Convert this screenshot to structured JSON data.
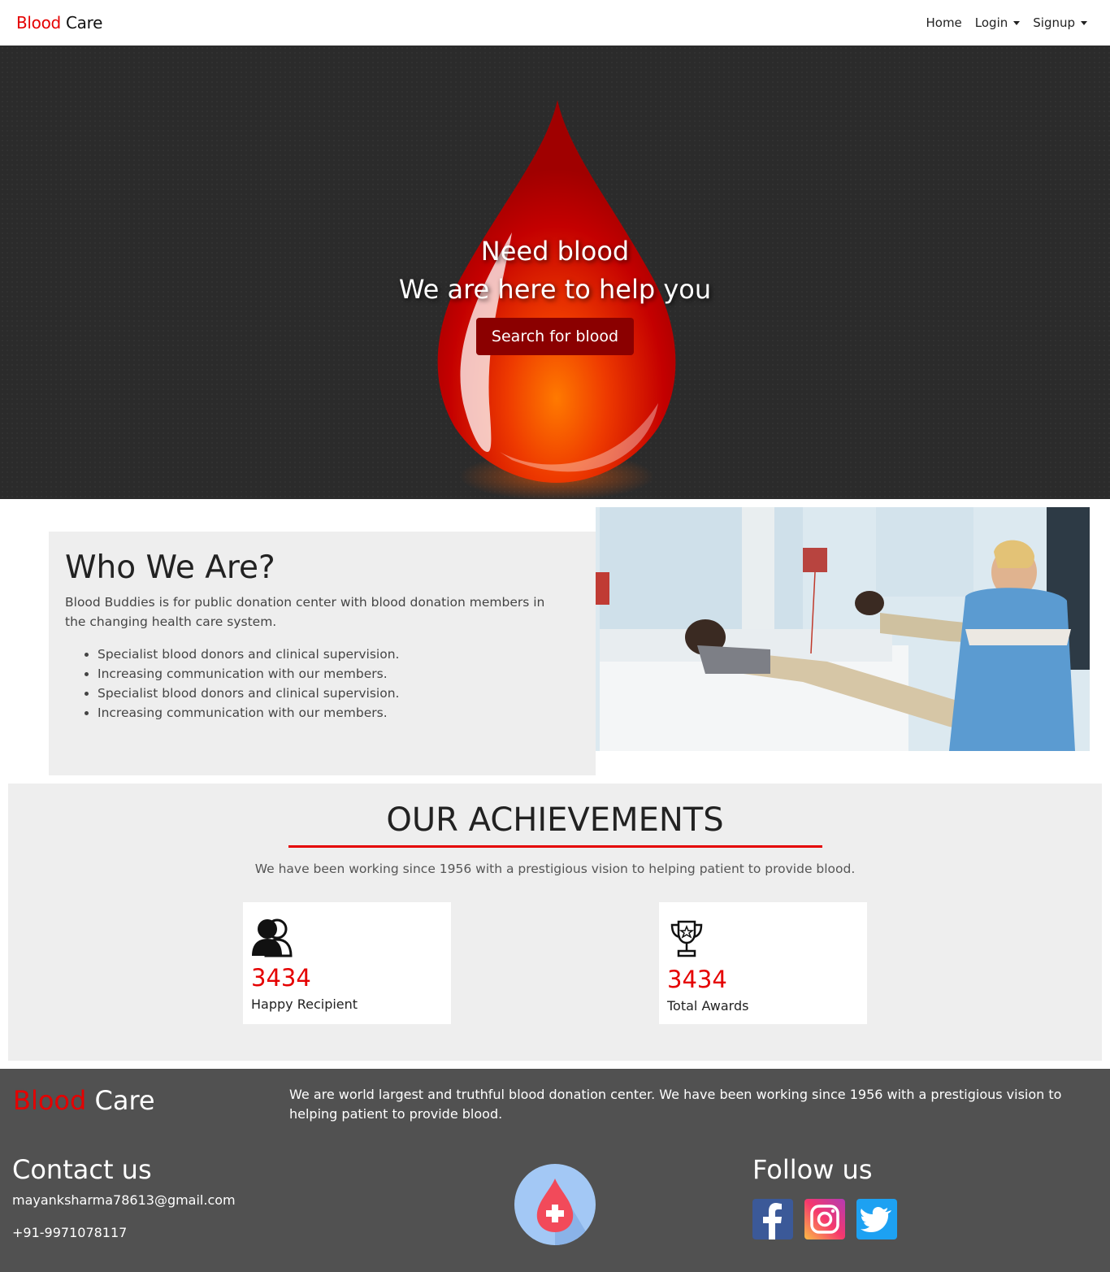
{
  "navbar": {
    "brand_red": "Blood",
    "brand_dark": "Care",
    "links": {
      "home": "Home",
      "login": "Login",
      "signup": "Signup"
    }
  },
  "hero": {
    "line1": "Need blood",
    "line2": "We are here to help you",
    "button": "Search for blood"
  },
  "about": {
    "title": "Who We Are?",
    "description": "Blood Buddies is for public donation center with blood donation members in the changing health care system.",
    "bullets": [
      "Specialist blood donors and clinical supervision.",
      "Increasing communication with our members.",
      "Specialist blood donors and clinical supervision.",
      "Increasing communication with our members."
    ]
  },
  "achievements": {
    "title": "OUR ACHIEVEMENTS",
    "subtitle": "We have been working since 1956 with a prestigious vision to helping patient to provide blood.",
    "cards": [
      {
        "icon": "users-icon",
        "number": "3434",
        "label": "Happy Recipient"
      },
      {
        "icon": "trophy-icon",
        "number": "3434",
        "label": "Total Awards"
      }
    ]
  },
  "footer": {
    "brand_red": "Blood",
    "brand_dark": "Care",
    "description": "We are world largest and truthful blood donation center. We have been working since 1956 with a prestigious vision to helping patient to provide blood.",
    "contact_title": "Contact us",
    "email": "mayanksharma78613@gmail.com",
    "phone": "+91-9971078117",
    "follow_title": "Follow us",
    "social": [
      "facebook-icon",
      "instagram-icon",
      "twitter-icon"
    ]
  },
  "colors": {
    "accent": "#e50000",
    "button": "#8b0000",
    "hero_bg": "#2b2b2b",
    "section_bg": "#eeeeee",
    "footer_bg": "#515151"
  }
}
